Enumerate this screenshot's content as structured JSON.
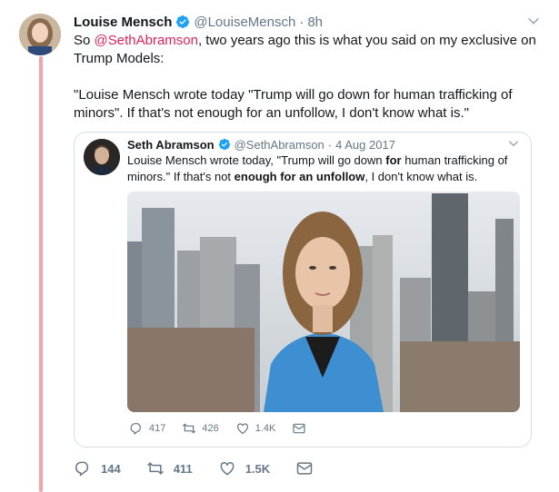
{
  "tweet": {
    "author_name": "Louise Mensch",
    "author_handle": "@LouiseMensch",
    "separator": "·",
    "time": "8h",
    "text_prefix": "So ",
    "mention": "@SethAbramson",
    "text_suffix": ", two years ago this is what you said on my exclusive on Trump Models:",
    "quote_paragraph": "\"Louise Mensch wrote today \"Trump will go down for human trafficking of minors\". If that's not enough for an unfollow, I don't know what is.\"",
    "actions": {
      "replies": "144",
      "retweets": "411",
      "likes": "1.5K"
    }
  },
  "quoted_tweet": {
    "author_name": "Seth Abramson",
    "author_handle": "@SethAbramson",
    "separator": "·",
    "date": "4 Aug 2017",
    "text_part1": "Louise Mensch wrote today, \"Trump will go down ",
    "text_bold1": "for",
    "text_part2": " human trafficking of minors.\" If that's not ",
    "text_bold2": "enough for an unfollow",
    "text_part3": ", I don't know what is.",
    "actions": {
      "replies": "417",
      "retweets": "426",
      "likes": "1.4K"
    }
  },
  "colors": {
    "accent": "#1da1f2",
    "mention": "#e0245e",
    "thread_line": "#f3a5a5",
    "muted": "#657786"
  },
  "icons": [
    "verified-icon",
    "chevron-down-icon",
    "reply-icon",
    "retweet-icon",
    "like-icon",
    "dm-icon"
  ]
}
